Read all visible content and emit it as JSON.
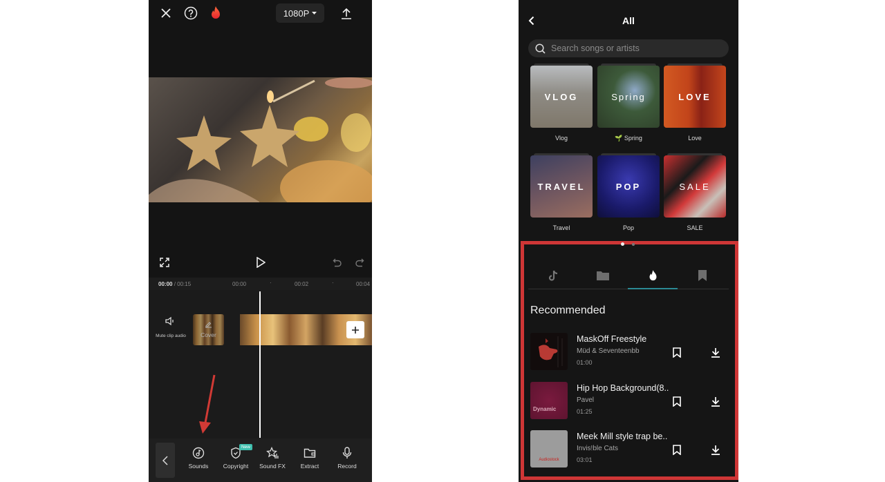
{
  "editor": {
    "top_bar": {
      "close_icon": "close-icon",
      "help_icon": "help-icon",
      "flame_icon": "flame-icon",
      "resolution": "1080P",
      "export_icon": "upload-icon"
    },
    "playback": {
      "fullscreen_icon": "fullscreen-icon",
      "play_icon": "play-icon",
      "undo_icon": "undo-icon",
      "redo_icon": "redo-icon"
    },
    "timeline": {
      "current_time": "00:00",
      "total_time": " / 00:15",
      "ticks": [
        "00:00",
        "00:02",
        "00:04"
      ],
      "mute_label": "Mute clip audio",
      "cover_label": "Cover",
      "add_icon": "plus-icon"
    },
    "toolbar": {
      "back_icon": "chevron-left-icon",
      "items": [
        {
          "label": "Sounds",
          "icon": "music-note-icon"
        },
        {
          "label": "Copyright",
          "icon": "shield-check-icon",
          "badge": "New"
        },
        {
          "label": "Sound FX",
          "icon": "star-sound-icon"
        },
        {
          "label": "Extract",
          "icon": "folder-icon"
        },
        {
          "label": "Record",
          "icon": "microphone-icon"
        }
      ]
    },
    "annotation_color": "#d13a35"
  },
  "music": {
    "header": {
      "title": "All",
      "back_icon": "chevron-left-icon"
    },
    "search": {
      "placeholder": "Search songs or artists"
    },
    "categories": [
      {
        "overlay": "VLOG",
        "label": "Vlog"
      },
      {
        "overlay": "Spring",
        "label": "🌱 Spring"
      },
      {
        "overlay": "LOVE",
        "label": "Love"
      },
      {
        "overlay": "TRAVEL",
        "label": "Travel"
      },
      {
        "overlay": "POP",
        "label": "Pop"
      },
      {
        "overlay": "SALE",
        "label": "SALE"
      }
    ],
    "tabs": [
      {
        "icon": "tiktok-icon",
        "active": false
      },
      {
        "icon": "folder-icon",
        "active": false
      },
      {
        "icon": "flame-icon",
        "active": true
      },
      {
        "icon": "bookmark-icon",
        "active": false
      }
    ],
    "section_title": "Recommended",
    "songs": [
      {
        "title": "MaskOff Freestyle",
        "artist": "Müd & Seventeenbb",
        "duration": "01:00"
      },
      {
        "title": "Hip Hop Background(8..",
        "artist": "Pavel",
        "duration": "01:25",
        "cover_text": "Dynamic"
      },
      {
        "title": "Meek Mill style trap be..",
        "artist": "Invis!ble Cats",
        "duration": "03:01",
        "cover_text": "Audiostock"
      }
    ],
    "highlight_color": "#cf3636",
    "accent_color": "#2b8a94"
  }
}
